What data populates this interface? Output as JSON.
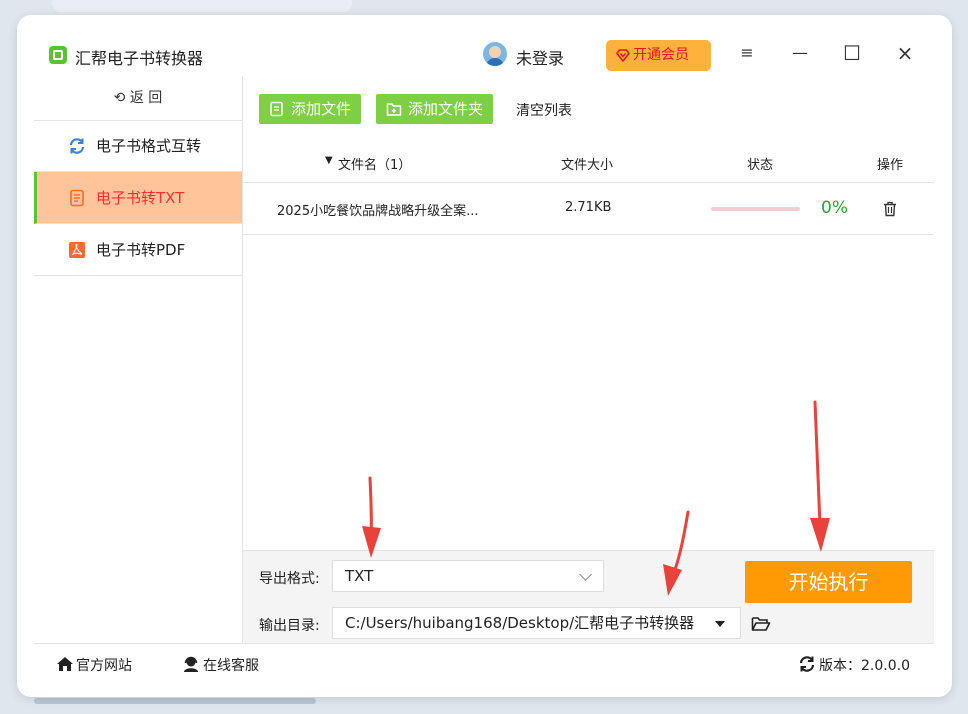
{
  "app": {
    "title": "汇帮电子书转换器",
    "login_text": "未登录",
    "vip_label": "开通会员"
  },
  "window_controls": {
    "menu": "≡",
    "minimize": "—",
    "maximize": "☐",
    "close": "×"
  },
  "sidebar": {
    "back_label": "返  回",
    "items": [
      {
        "label": "电子书格式互转",
        "icon": "refresh-icon",
        "active": false
      },
      {
        "label": "电子书转TXT",
        "icon": "document-icon",
        "active": true
      },
      {
        "label": "电子书转PDF",
        "icon": "pdf-icon",
        "active": false
      }
    ]
  },
  "toolbar": {
    "add_file": "添加文件",
    "add_folder": "添加文件夹",
    "clear_list": "清空列表"
  },
  "table": {
    "headers": {
      "filename": "文件名（1）",
      "filesize": "文件大小",
      "status": "状态",
      "action": "操作"
    },
    "rows": [
      {
        "filename": "2025小吃餐饮品牌战略升级全案...",
        "filesize": "2.71KB",
        "progress": 0,
        "progress_label": "0%"
      }
    ]
  },
  "options": {
    "format_label": "导出格式:",
    "format_value": "TXT",
    "dir_label": "输出目录:",
    "dir_value": "C:/Users/huibang168/Desktop/汇帮电子书转换器",
    "start_label": "开始执行"
  },
  "footer": {
    "website": "官方网站",
    "service": "在线客服",
    "version": "版本：2.0.0.0"
  },
  "colors": {
    "accent_green": "#7fcf45",
    "active_bg": "#ffc499",
    "active_text": "#ff2d2d",
    "start_orange": "#ff9a05",
    "vip_orange": "#ffb13d",
    "arrow_red": "#e8423a"
  }
}
